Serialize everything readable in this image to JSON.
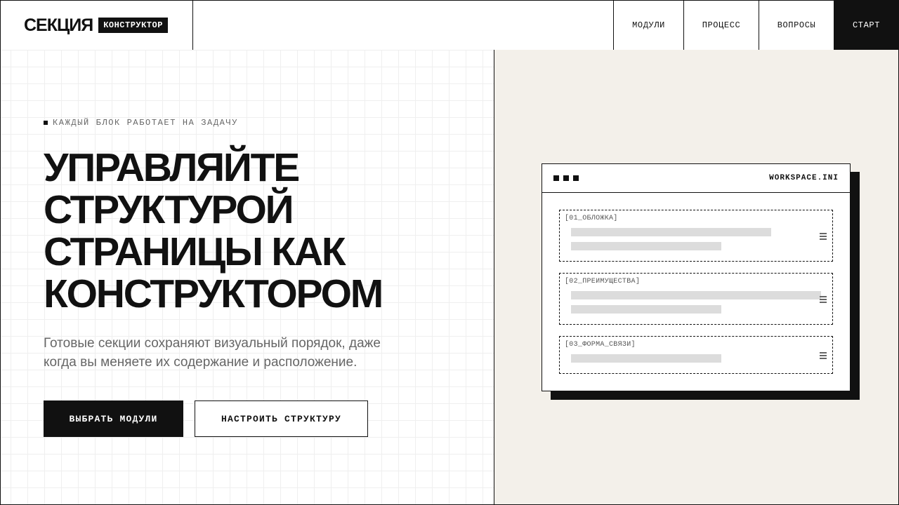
{
  "brand": {
    "name": "СЕКЦИЯ",
    "tag": "КОНСТРУКТОР"
  },
  "nav": {
    "items": [
      {
        "label": "МОДУЛИ"
      },
      {
        "label": "ПРОЦЕСС"
      },
      {
        "label": "ВОПРОСЫ"
      }
    ],
    "cta": "СТАРТ"
  },
  "hero": {
    "eyebrow": "КАЖДЫЙ БЛОК РАБОТАЕТ НА ЗАДАЧУ",
    "headline_lines": [
      "УПРАВЛЯЙТЕ",
      "СТРУКТУРОЙ",
      "СТРАНИЦЫ КАК",
      "КОНСТРУКТОРОМ"
    ],
    "lead_lines": [
      "Готовые секции сохраняют визуальный порядок, даже",
      "когда вы меняете их содержание и расположение."
    ],
    "primary_button": "ВЫБРАТЬ МОДУЛИ",
    "secondary_button": "НАСТРОИТЬ СТРУКТУРУ"
  },
  "workspace": {
    "title": "WORKSPACE.INI",
    "modules": [
      {
        "label": "[01_ОБЛОЖКА]"
      },
      {
        "label": "[02_ПРЕИМУЩЕСТВА]"
      },
      {
        "label": "[03_ФОРМА_СВЯЗИ]"
      }
    ]
  },
  "colors": {
    "ink": "#111111",
    "panel": "#f3f0ea",
    "muted": "#666666",
    "placeholder": "#dcdcdc"
  }
}
